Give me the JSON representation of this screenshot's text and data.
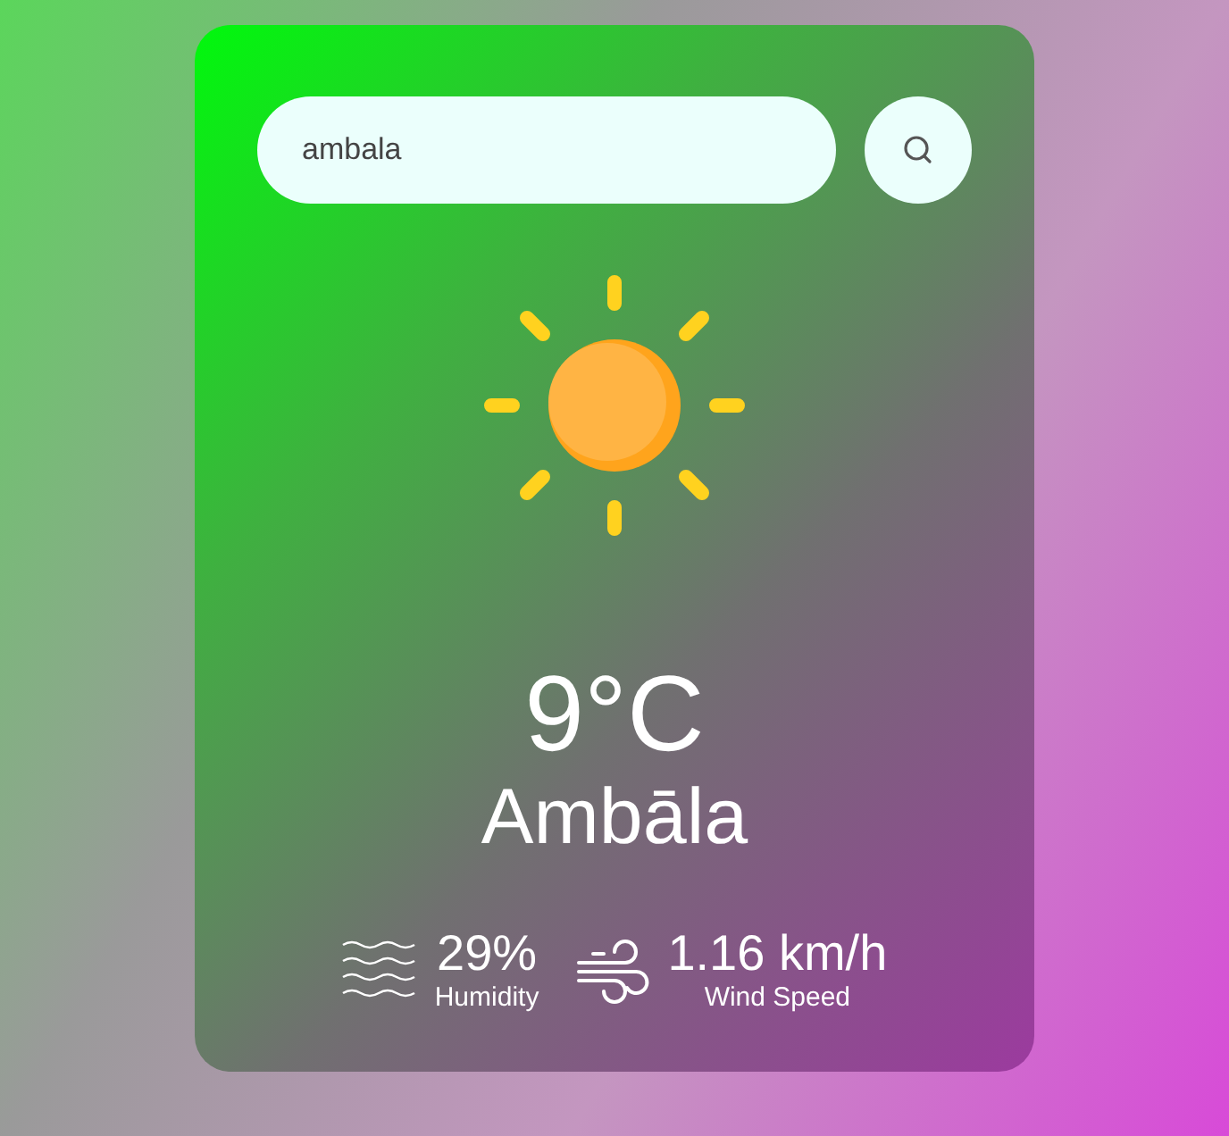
{
  "search": {
    "value": "ambala"
  },
  "weather": {
    "temperature": "9°C",
    "city": "Ambāla"
  },
  "details": [
    {
      "kind": "humidity",
      "value": "29%",
      "label": "Humidity"
    },
    {
      "kind": "wind",
      "value": "1.16 km/h",
      "label": "Wind Speed"
    }
  ]
}
